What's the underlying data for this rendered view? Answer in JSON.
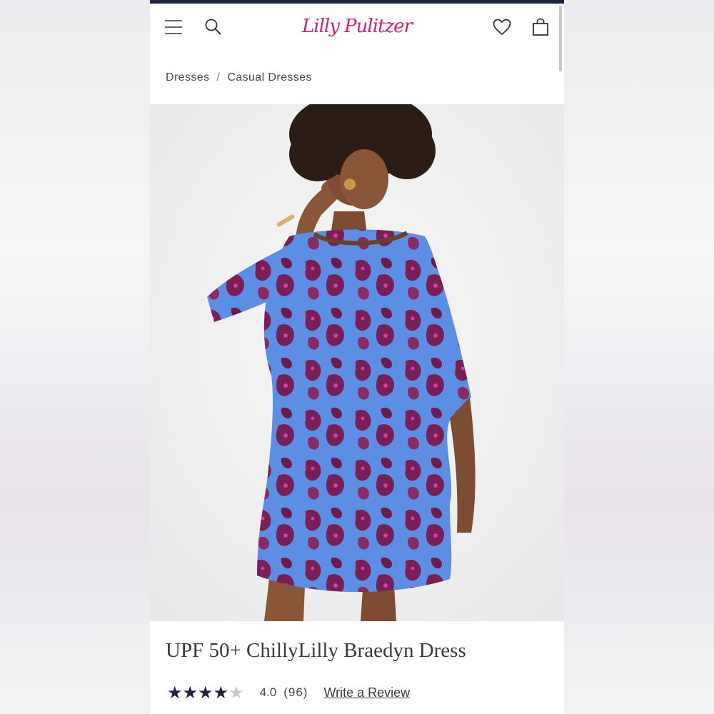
{
  "header": {
    "logo_text": "Lilly Pulitzer",
    "brand_color": "#d0217a",
    "top_bar_color": "#1c2340",
    "icons": [
      "menu-icon",
      "search-icon",
      "heart-icon",
      "shopping-bag-icon"
    ]
  },
  "breadcrumb": {
    "items": [
      "Dresses",
      "Casual Dresses"
    ],
    "separator": "/"
  },
  "product": {
    "image": {
      "dress_colors": [
        "#5b8fe6",
        "#7a1f55"
      ]
    },
    "title": "UPF 50+ ChillyLilly Braedyn Dress",
    "rating": {
      "value": "4.0",
      "count": "(96)",
      "stars_filled": 4,
      "stars_total": 5,
      "write_review_label": "Write a Review"
    }
  }
}
